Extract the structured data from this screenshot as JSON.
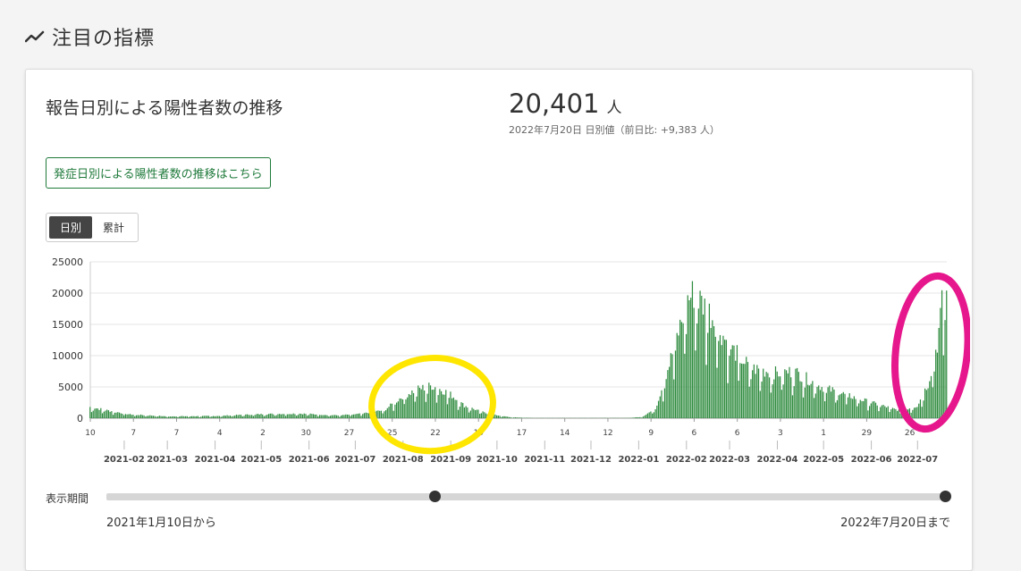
{
  "section": {
    "title": "注目の指標",
    "icon": "trend-line-icon"
  },
  "card": {
    "title": "報告日別による陽性者数の推移",
    "value": "20,401",
    "unit": "人",
    "sub": "2022年7月20日 日別値（前日比: +9,383 人）",
    "onset_link": "発症日別による陽性者数の推移はこちら",
    "toggle": {
      "daily": "日別",
      "cumulative": "累計",
      "selected": "daily"
    }
  },
  "period": {
    "label": "表示期間",
    "from": "2021年1月10日から",
    "to": "2022年7月20日まで",
    "mid_handle_fraction": 0.39,
    "end_handle_fraction": 1.0
  },
  "colors": {
    "bar": "#2e8b3e",
    "grid": "#e6e6e6",
    "accent": "#1f7a3b",
    "yellow_mark": "#ffe600",
    "pink_mark": "#e6178c"
  },
  "chart_data": {
    "type": "bar",
    "title": "",
    "xlabel": "",
    "ylabel": "",
    "ylim": [
      0,
      25000
    ],
    "yticks": [
      "0",
      "5000",
      "10000",
      "15000",
      "20000",
      "25000"
    ],
    "grid": true,
    "x_start": "2021-01-10",
    "x_end": "2022-07-20",
    "x_day_ticks": [
      {
        "date": "2021-01-10",
        "label": "10"
      },
      {
        "date": "2021-02-07",
        "label": "7"
      },
      {
        "date": "2021-03-07",
        "label": "7"
      },
      {
        "date": "2021-04-04",
        "label": "4"
      },
      {
        "date": "2021-05-02",
        "label": "2"
      },
      {
        "date": "2021-05-30",
        "label": "30"
      },
      {
        "date": "2021-06-27",
        "label": "27"
      },
      {
        "date": "2021-07-25",
        "label": "25"
      },
      {
        "date": "2021-08-22",
        "label": "22"
      },
      {
        "date": "2021-09-19",
        "label": "19"
      },
      {
        "date": "2021-10-17",
        "label": "17"
      },
      {
        "date": "2021-11-14",
        "label": "14"
      },
      {
        "date": "2021-12-12",
        "label": "12"
      },
      {
        "date": "2022-01-09",
        "label": "9"
      },
      {
        "date": "2022-02-06",
        "label": "6"
      },
      {
        "date": "2022-03-06",
        "label": "6"
      },
      {
        "date": "2022-04-03",
        "label": "3"
      },
      {
        "date": "2022-05-01",
        "label": "1"
      },
      {
        "date": "2022-05-29",
        "label": "29"
      },
      {
        "date": "2022-06-26",
        "label": "26"
      }
    ],
    "x_month_ticks": [
      {
        "date": "2021-02-01",
        "label": "2021-02"
      },
      {
        "date": "2021-03-01",
        "label": "2021-03"
      },
      {
        "date": "2021-04-01",
        "label": "2021-04"
      },
      {
        "date": "2021-05-01",
        "label": "2021-05"
      },
      {
        "date": "2021-06-01",
        "label": "2021-06"
      },
      {
        "date": "2021-07-01",
        "label": "2021-07"
      },
      {
        "date": "2021-08-01",
        "label": "2021-08"
      },
      {
        "date": "2021-09-01",
        "label": "2021-09"
      },
      {
        "date": "2021-10-01",
        "label": "2021-10"
      },
      {
        "date": "2021-11-01",
        "label": "2021-11"
      },
      {
        "date": "2021-12-01",
        "label": "2021-12"
      },
      {
        "date": "2022-01-01",
        "label": "2022-01"
      },
      {
        "date": "2022-02-01",
        "label": "2022-02"
      },
      {
        "date": "2022-03-01",
        "label": "2022-03"
      },
      {
        "date": "2022-04-01",
        "label": "2022-04"
      },
      {
        "date": "2022-05-01",
        "label": "2022-05"
      },
      {
        "date": "2022-06-01",
        "label": "2022-06"
      },
      {
        "date": "2022-07-01",
        "label": "2022-07"
      }
    ],
    "trend_points": [
      {
        "date": "2021-01-10",
        "value": 1800
      },
      {
        "date": "2021-01-20",
        "value": 1300
      },
      {
        "date": "2021-02-05",
        "value": 600
      },
      {
        "date": "2021-03-01",
        "value": 300
      },
      {
        "date": "2021-04-01",
        "value": 350
      },
      {
        "date": "2021-05-01",
        "value": 650
      },
      {
        "date": "2021-05-25",
        "value": 750
      },
      {
        "date": "2021-06-20",
        "value": 450
      },
      {
        "date": "2021-07-05",
        "value": 700
      },
      {
        "date": "2021-07-20",
        "value": 1300
      },
      {
        "date": "2021-08-01",
        "value": 3500
      },
      {
        "date": "2021-08-10",
        "value": 4600
      },
      {
        "date": "2021-08-20",
        "value": 5200
      },
      {
        "date": "2021-08-31",
        "value": 4000
      },
      {
        "date": "2021-09-10",
        "value": 2000
      },
      {
        "date": "2021-09-25",
        "value": 700
      },
      {
        "date": "2021-10-10",
        "value": 150
      },
      {
        "date": "2021-10-25",
        "value": 30
      },
      {
        "date": "2021-12-25",
        "value": 40
      },
      {
        "date": "2022-01-03",
        "value": 200
      },
      {
        "date": "2022-01-12",
        "value": 1500
      },
      {
        "date": "2022-01-22",
        "value": 9500
      },
      {
        "date": "2022-02-02",
        "value": 19000
      },
      {
        "date": "2022-02-06",
        "value": 20000
      },
      {
        "date": "2022-02-16",
        "value": 17000
      },
      {
        "date": "2022-03-01",
        "value": 11500
      },
      {
        "date": "2022-03-15",
        "value": 8000
      },
      {
        "date": "2022-04-01",
        "value": 7200
      },
      {
        "date": "2022-04-12",
        "value": 7500
      },
      {
        "date": "2022-04-30",
        "value": 5000
      },
      {
        "date": "2022-05-15",
        "value": 3800
      },
      {
        "date": "2022-06-01",
        "value": 2500
      },
      {
        "date": "2022-06-20",
        "value": 1200
      },
      {
        "date": "2022-07-01",
        "value": 2000
      },
      {
        "date": "2022-07-08",
        "value": 5500
      },
      {
        "date": "2022-07-14",
        "value": 12000
      },
      {
        "date": "2022-07-17",
        "value": 18000
      },
      {
        "date": "2022-07-20",
        "value": 20401
      }
    ],
    "annotations": [
      {
        "shape": "ellipse",
        "color": "yellow",
        "around": "2021-08 wave"
      },
      {
        "shape": "ellipse",
        "color": "magenta",
        "around": "2022-07 wave"
      }
    ]
  }
}
